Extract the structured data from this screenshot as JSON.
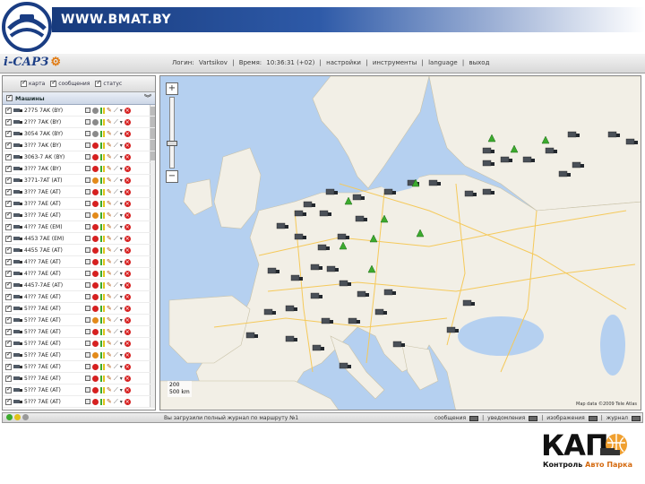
{
  "brand": {
    "url": "WWW.BMAT.BY"
  },
  "app": {
    "logo_text": "i-САРЗ",
    "status": {
      "login_label": "Логин:",
      "login_value": "Vartsikov",
      "time_label": "Время:",
      "time_value": "10:36:31 (+02)",
      "menu": [
        "настройки",
        "инструменты",
        "language",
        "выход"
      ]
    }
  },
  "left_panel": {
    "modes": [
      {
        "label": "карта",
        "checked": true
      },
      {
        "label": "сообщения",
        "checked": true
      },
      {
        "label": "статус",
        "checked": true
      }
    ],
    "vehicles_header": "Машины",
    "vehicles": [
      {
        "name": "2775 7AK (BY)",
        "status": "gray"
      },
      {
        "name": "2??? 7AK (BY)",
        "status": "gray"
      },
      {
        "name": "3054 7AK (BY)",
        "status": "gray"
      },
      {
        "name": "3??? 7AK (BY)",
        "status": "red"
      },
      {
        "name": "3063-7 AK (BY)",
        "status": "red"
      },
      {
        "name": "3??? 7AK (BY)",
        "status": "red"
      },
      {
        "name": "3771-7AT (AT)",
        "status": "orange"
      },
      {
        "name": "3??? 7AE (AT)",
        "status": "red"
      },
      {
        "name": "3??? 7AE (AT)",
        "status": "red"
      },
      {
        "name": "3??? 7AE (AT)",
        "status": "orange"
      },
      {
        "name": "4??? 7AE (EM)",
        "status": "red"
      },
      {
        "name": "4453 7AE (EM)",
        "status": "red"
      },
      {
        "name": "4455 7AE (AT)",
        "status": "red"
      },
      {
        "name": "4??? 7AE (AT)",
        "status": "red"
      },
      {
        "name": "4??? 7AE (AT)",
        "status": "red"
      },
      {
        "name": "4457-7AE (AT)",
        "status": "red"
      },
      {
        "name": "4??? 7AE (AT)",
        "status": "red"
      },
      {
        "name": "5??? 7AE (AT)",
        "status": "red"
      },
      {
        "name": "5??? 7AE (AT)",
        "status": "orange"
      },
      {
        "name": "5??? 7AE (AT)",
        "status": "red"
      },
      {
        "name": "5??? 7AE (AT)",
        "status": "red"
      },
      {
        "name": "5??? 7AE (AT)",
        "status": "orange"
      },
      {
        "name": "5??? 7AE (AT)",
        "status": "red"
      },
      {
        "name": "5??? 7AE (AT)",
        "status": "red"
      },
      {
        "name": "5??? 7AE (AT)",
        "status": "red"
      },
      {
        "name": "5??? 7AE (AT)",
        "status": "red"
      }
    ]
  },
  "map": {
    "zoom_in": "+",
    "zoom_out": "−",
    "scale": "200\n500 km",
    "copyright": "Map data ©2009 Tele Atlas"
  },
  "bottom_bar": {
    "center_text": "Вы загрузили полный журнал по маршруту №1",
    "items": [
      "сообщения",
      "уведомления",
      "изображения",
      "журнал"
    ]
  },
  "footer_logo": {
    "text": "КАП",
    "subtitle_a": "Контроль",
    "subtitle_b": "Авто Парка"
  },
  "colors": {
    "brand_blue": "#173a7c",
    "status_red": "#d62020",
    "status_orange": "#e38a1a",
    "status_gray": "#8a8a8a",
    "bar_green": "#3caa2e",
    "bar_yellow": "#e0c21a",
    "water": "#b5d0f0",
    "land": "#f2efe6"
  }
}
